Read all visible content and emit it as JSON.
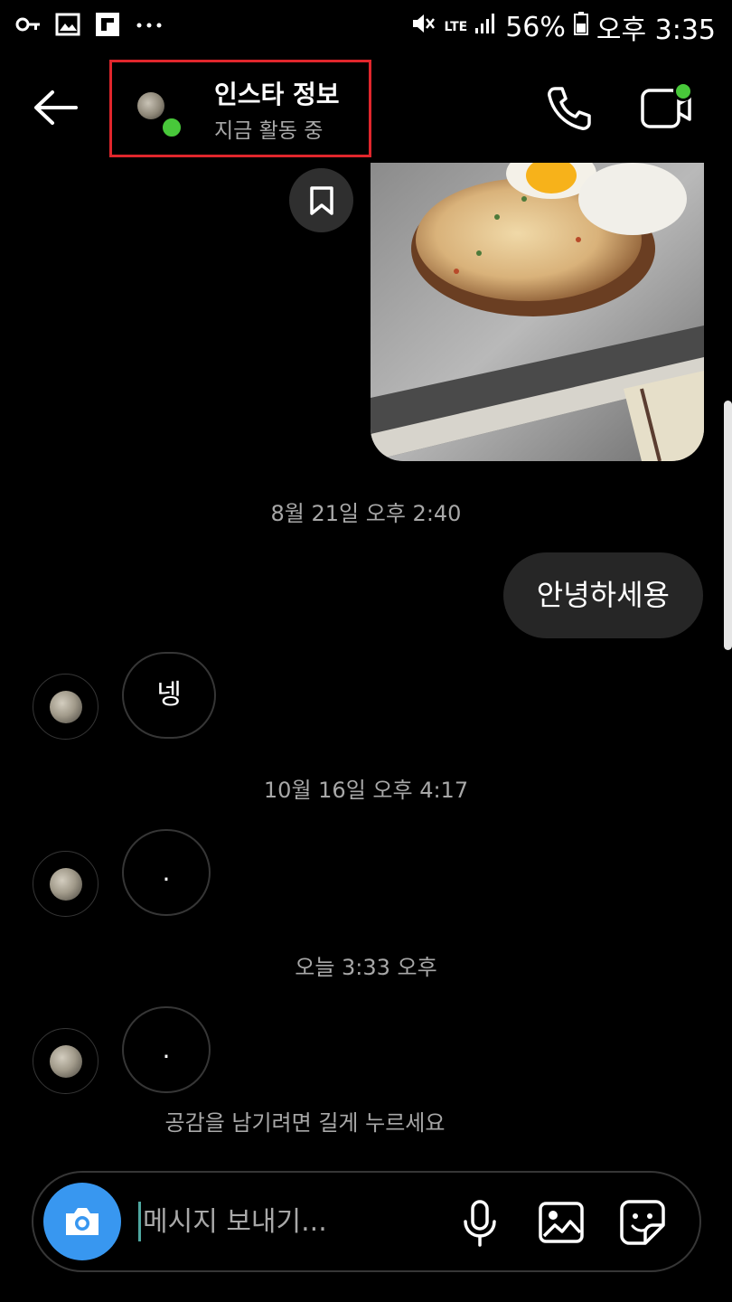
{
  "status_bar": {
    "battery": "56%",
    "time": "오후 3:35",
    "network": "LTE"
  },
  "header": {
    "name": "인스타 정보",
    "status": "지금 활동 중",
    "online_color": "#48c83a",
    "highlight_color": "#e0262c"
  },
  "messages": {
    "ts1": "8월 21일 오후 2:40",
    "outgoing_text": "안녕하세용",
    "incoming_1": "넹",
    "ts2": "10월 16일 오후 4:17",
    "incoming_2": ".",
    "ts3": "오늘 3:33 오후",
    "incoming_3": ".",
    "hint": "공감을 남기려면 길게 누르세요"
  },
  "composer": {
    "placeholder": "메시지 보내기...",
    "accent_color": "#3897f0"
  }
}
